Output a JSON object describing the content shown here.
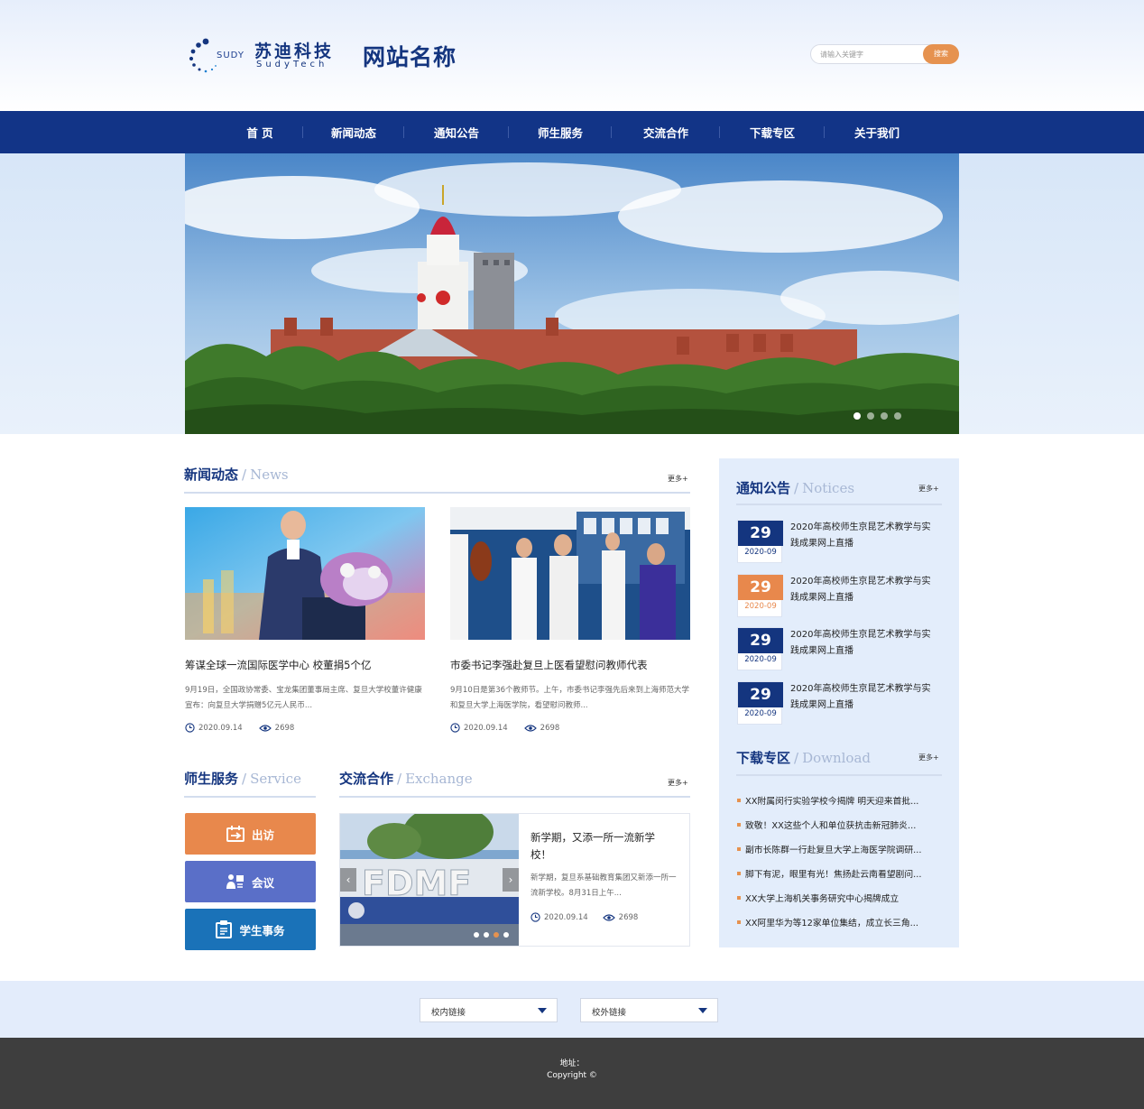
{
  "header": {
    "logo_small": "SUDY",
    "logo_cn": "苏迪科技",
    "logo_en": "SudyTech",
    "site_name": "网站名称",
    "search_placeholder": "请输入关键字",
    "search_button": "搜索"
  },
  "nav": {
    "items": [
      {
        "label": "首 页"
      },
      {
        "label": "新闻动态"
      },
      {
        "label": "通知公告"
      },
      {
        "label": "师生服务"
      },
      {
        "label": "交流合作"
      },
      {
        "label": "下载专区"
      },
      {
        "label": "关于我们"
      }
    ]
  },
  "banner": {
    "slide_count": 4,
    "active_slide": 1
  },
  "news": {
    "title_cn": "新闻动态",
    "title_en": "News",
    "more": "更多+",
    "items": [
      {
        "title": "筹谋全球一流国际医学中心 校董捐5个亿",
        "desc": "9月19日，全国政协常委、宝龙集团董事局主席、复旦大学校董许健康宣布：向复旦大学捐赠5亿元人民币...",
        "date": "2020.09.14",
        "views": "2698"
      },
      {
        "title": "市委书记李强赴复旦上医看望慰问教师代表",
        "desc": "9月10日是第36个教师节。上午，市委书记李强先后来到上海师范大学和复旦大学上海医学院，看望慰问教师...",
        "date": "2020.09.14",
        "views": "2698"
      }
    ]
  },
  "service": {
    "title_cn": "师生服务",
    "title_en": "Service",
    "buttons": [
      {
        "label": "出访",
        "color": "#e8884c"
      },
      {
        "label": "会议",
        "color": "#5a6fc8"
      },
      {
        "label": "学生事务",
        "color": "#1a72b8"
      }
    ]
  },
  "exchange": {
    "title_cn": "交流合作",
    "title_en": "Exchange",
    "more": "更多+",
    "item": {
      "title": "新学期，又添一所一流新学校！",
      "desc": "新学期，复旦系基础教育集团又新添一所一流新学校。8月31日上午...",
      "date": "2020.09.14",
      "views": "2698"
    },
    "slide_count": 4,
    "active_slide": 2
  },
  "notices": {
    "title_cn": "通知公告",
    "title_en": "Notices",
    "more": "更多+",
    "items": [
      {
        "day": "29",
        "ym": "2020-09",
        "text": "2020年高校师生京昆艺术教学与实践成果网上直播",
        "accent": "#14357f"
      },
      {
        "day": "29",
        "ym": "2020-09",
        "text": "2020年高校师生京昆艺术教学与实践成果网上直播",
        "accent": "#e8884c"
      },
      {
        "day": "29",
        "ym": "2020-09",
        "text": "2020年高校师生京昆艺术教学与实践成果网上直播",
        "accent": "#14357f"
      },
      {
        "day": "29",
        "ym": "2020-09",
        "text": "2020年高校师生京昆艺术教学与实践成果网上直播",
        "accent": "#14357f"
      }
    ]
  },
  "download": {
    "title_cn": "下载专区",
    "title_en": "Download",
    "more": "更多+",
    "items": [
      "XX附属闵行实验学校今揭牌 明天迎来首批...",
      "致敬！XX这些个人和单位获抗击新冠肺炎...",
      "副市长陈群一行赴复旦大学上海医学院调研...",
      "脚下有泥，眼里有光！焦扬赴云南看望剧问...",
      "XX大学上海机关事务研究中心揭牌成立",
      "XX阿里华为等12家单位集结，成立长三角..."
    ]
  },
  "links": {
    "internal": "校内链接",
    "external": "校外链接"
  },
  "footer": {
    "address": "地址：",
    "copyright": "Copyright ©"
  },
  "colors": {
    "brand": "#14357f",
    "nav_bg": "#123487",
    "accent": "#e6924f"
  }
}
